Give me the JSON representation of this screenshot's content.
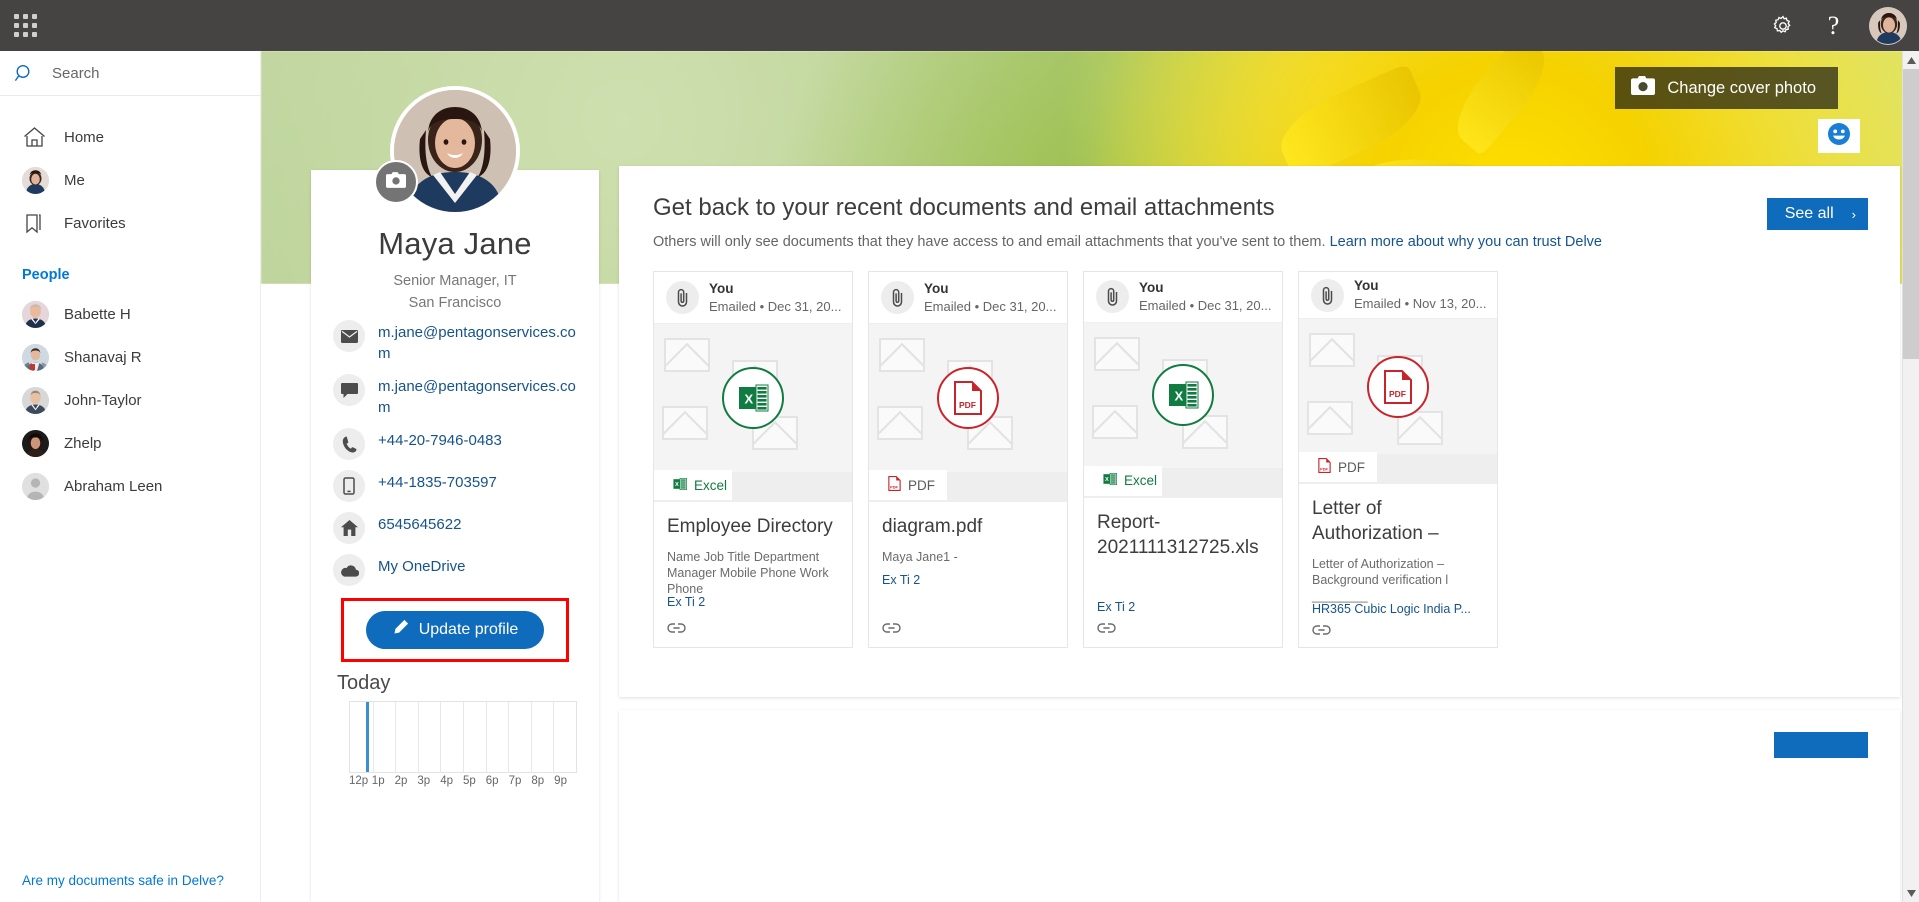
{
  "suitebar": {
    "waffle_label": "app-launcher",
    "settings_label": "Settings",
    "help_label": "?",
    "avatar_label": "Maya Jane"
  },
  "search": {
    "placeholder": "Search",
    "value": ""
  },
  "sidebar": {
    "items": [
      {
        "label": "Home",
        "icon": "home-icon"
      },
      {
        "label": "Me",
        "icon": "avatar-icon"
      },
      {
        "label": "Favorites",
        "icon": "bookmark-icon"
      }
    ],
    "people_heading": "People",
    "people": [
      {
        "label": "Babette H"
      },
      {
        "label": "Shanavaj R"
      },
      {
        "label": "John-Taylor"
      },
      {
        "label": "Zhelp"
      },
      {
        "label": "Abraham Leen"
      }
    ],
    "footer_link": "Are my documents safe in Delve?"
  },
  "cover": {
    "change_cover_label": "Change cover photo",
    "feedback_icon": "smiley-icon"
  },
  "profile": {
    "name": "Maya Jane",
    "title": "Senior Manager, IT",
    "location": "San Francisco",
    "contacts": [
      {
        "icon": "envelope-icon",
        "value": "m.jane@pentagonservices.com"
      },
      {
        "icon": "chat-icon",
        "value": "m.jane@pentagonservices.com"
      },
      {
        "icon": "phone-icon",
        "value": "+44-20-7946-0483"
      },
      {
        "icon": "mobile-icon",
        "value": "+44-1835-703597"
      },
      {
        "icon": "home-icon",
        "value": "6545645622"
      },
      {
        "icon": "cloud-icon",
        "value": "My OneDrive"
      }
    ],
    "update_button": "Update profile",
    "today_label": "Today",
    "axis_labels": [
      "12p",
      "1p",
      "2p",
      "3p",
      "4p",
      "5p",
      "6p",
      "7p",
      "8p",
      "9p"
    ]
  },
  "documents": {
    "title": "Get back to your recent documents and email attachments",
    "subtitle_part1": "Others will only see documents that they have access to and email attachments that you've sent to them. ",
    "subtitle_link": "Learn more about why you can trust Delve",
    "see_all": "See all",
    "see_all_chevron": "›",
    "cards": [
      {
        "who": "You",
        "when": "Emailed • Dec 31, 20...",
        "type": "Excel",
        "type_kind": "excel",
        "title": "Employee Directory",
        "desc": "Name Job Title Department Manager Mobile Phone Work Phone",
        "link": "Ex Ti 2"
      },
      {
        "who": "You",
        "when": "Emailed • Dec 31, 20...",
        "type": "PDF",
        "type_kind": "pdf",
        "title": "diagram.pdf",
        "desc": "Maya Jane1 -",
        "link": "Ex Ti 2"
      },
      {
        "who": "You",
        "when": "Emailed • Dec 31, 20...",
        "type": "Excel",
        "type_kind": "excel",
        "title": "Report-2021111312725.xls",
        "desc": "",
        "link": "Ex Ti 2"
      },
      {
        "who": "You",
        "when": "Emailed • Nov 13, 20...",
        "type": "PDF",
        "type_kind": "pdf",
        "title": "Letter of Authorization –",
        "desc": "Letter of Authorization – Background verification l ________",
        "link": "HR365 Cubic Logic India P..."
      }
    ]
  },
  "colors": {
    "accent": "#0f6cbd",
    "link": "#16538d",
    "suitebar": "#464442",
    "highlight": "#ff0000",
    "excel": "#107c41",
    "pdf": "#c8242b"
  }
}
